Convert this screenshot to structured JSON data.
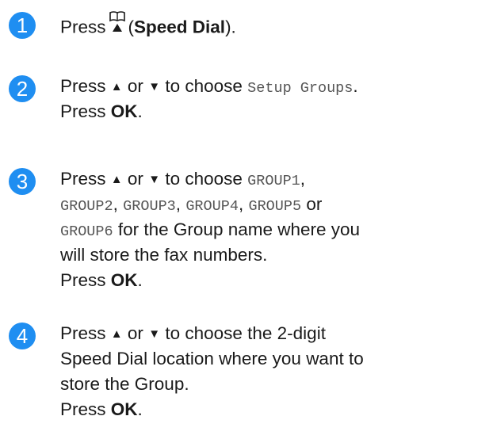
{
  "steps": [
    {
      "number": "1",
      "lines": [
        {
          "press": "Press",
          "paren_open": "(",
          "button": "Speed Dial",
          "paren_close": ")."
        }
      ]
    },
    {
      "number": "2",
      "line1": {
        "press": "Press",
        "up": "▲",
        "or": "or",
        "down": "▼",
        "to_choose": "to choose",
        "option": "Setup Groups",
        "period": "."
      },
      "line2": {
        "press": "Press",
        "ok": "OK",
        "period": "."
      }
    },
    {
      "number": "3",
      "line1": {
        "press": "Press",
        "up": "▲",
        "or": "or",
        "down": "▼",
        "to_choose": "to choose",
        "group1": "GROUP1",
        "comma": ","
      },
      "line2": {
        "group2": "GROUP2",
        "group3": "GROUP3",
        "group4": "GROUP4",
        "group5": "GROUP5",
        "or": "or",
        "sep": ","
      },
      "line3": {
        "group6": "GROUP6",
        "text": "for the Group name where you"
      },
      "line4": "will store the fax numbers.",
      "line5": {
        "press": "Press",
        "ok": "OK",
        "period": "."
      }
    },
    {
      "number": "4",
      "line1": {
        "press": "Press",
        "up": "▲",
        "or": "or",
        "down": "▼",
        "text": "to choose the 2-digit"
      },
      "line2": "Speed Dial location where you want to",
      "line3": "store the Group.",
      "line4": {
        "press": "Press",
        "ok": "OK",
        "period": "."
      }
    }
  ],
  "colors": {
    "badge": "#1f8ef1",
    "text": "#1a1a1a",
    "mono_text": "#555555"
  },
  "icons": {
    "speed_dial": "open-book-with-up-triangle"
  }
}
